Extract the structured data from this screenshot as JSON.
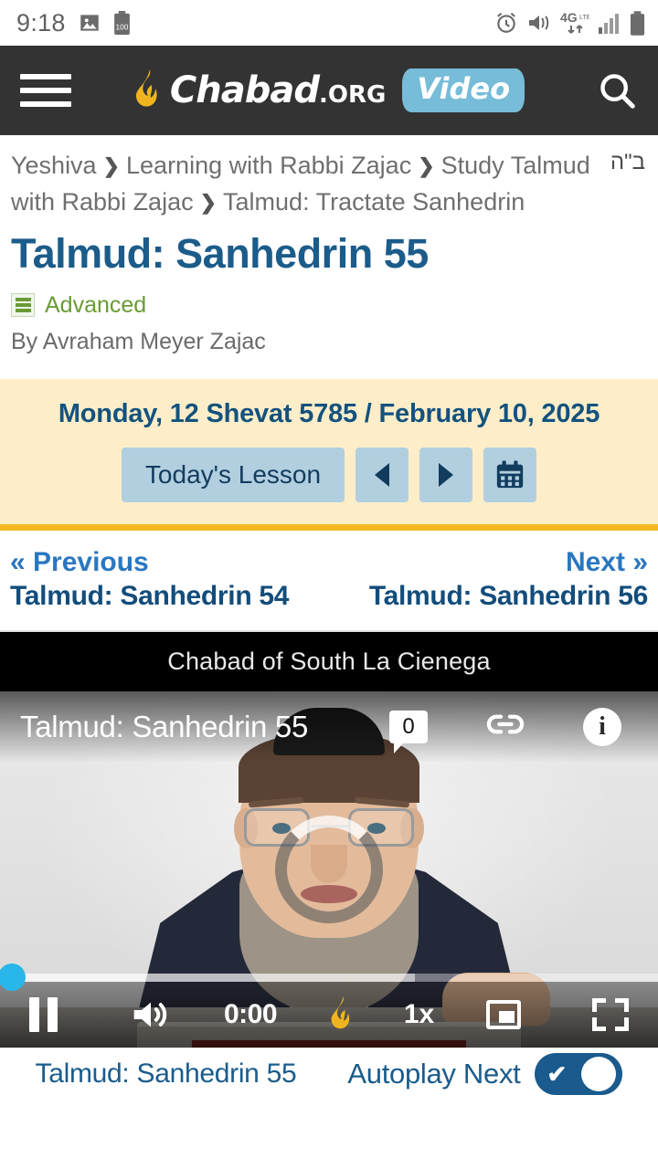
{
  "status_bar": {
    "time": "9:18",
    "battery_level": "100",
    "icons": [
      "photo-icon",
      "battery-100-icon",
      "alarm-icon",
      "vibrate-icon",
      "4g-lte-icon",
      "signal-bars-icon",
      "battery-icon"
    ]
  },
  "header": {
    "menu_icon": "hamburger-menu-icon",
    "brand_name": "Chabad",
    "brand_suffix": ".ORG",
    "section_tag": "Video",
    "search_icon": "search-icon",
    "background": "#333333",
    "tag_color": "#77bcd8"
  },
  "breadcrumb": {
    "bah": "ב\"ה",
    "items": [
      "Yeshiva",
      "Learning with Rabbi Zajac",
      "Study Talmud with Rabbi Zajac",
      "Talmud: Tractate Sanhedrin"
    ],
    "separator": "❯"
  },
  "article": {
    "title": "Talmud: Sanhedrin 55",
    "level": "Advanced",
    "level_icon": "level-bars-icon",
    "level_color": "#6a9b36",
    "byline": "By Avraham Meyer Zajac",
    "title_color": "#1b5c8a"
  },
  "date_bar": {
    "date_text": "Monday, 12 Shevat 5785 / February 10, 2025",
    "todays_lesson_label": "Today's Lesson",
    "prev_icon": "triangle-left-icon",
    "next_icon": "triangle-right-icon",
    "calendar_icon": "calendar-icon",
    "background": "#fdeec9",
    "border_color": "#f5b821",
    "button_color": "#b2cfdf"
  },
  "pagination": {
    "prev_label": "« Previous",
    "prev_title": "Talmud: Sanhedrin 54",
    "next_label": "Next »",
    "next_title": "Talmud: Sanhedrin 56"
  },
  "player": {
    "channel_name": "Chabad of South La Cienega",
    "overlay_title": "Talmud: Sanhedrin 55",
    "comment_count": "0",
    "comment_icon": "comment-bubble-icon",
    "link_icon": "link-chain-icon",
    "info_icon": "info-circle-icon",
    "spinner_icon": "loading-spinner-icon",
    "controls": {
      "pause_icon": "pause-icon",
      "volume_icon": "volume-on-icon",
      "current_time": "0:00",
      "logo_icon": "chabad-flame-icon",
      "playback_speed": "1x",
      "pip_icon": "picture-in-picture-icon",
      "fullscreen_icon": "fullscreen-icon"
    },
    "scrubber_color": "#29b6e8"
  },
  "footer": {
    "video_title": "Talmud: Sanhedrin 55",
    "autoplay_label": "Autoplay Next",
    "autoplay_enabled": "✔",
    "toggle_color": "#1a5a8c"
  }
}
